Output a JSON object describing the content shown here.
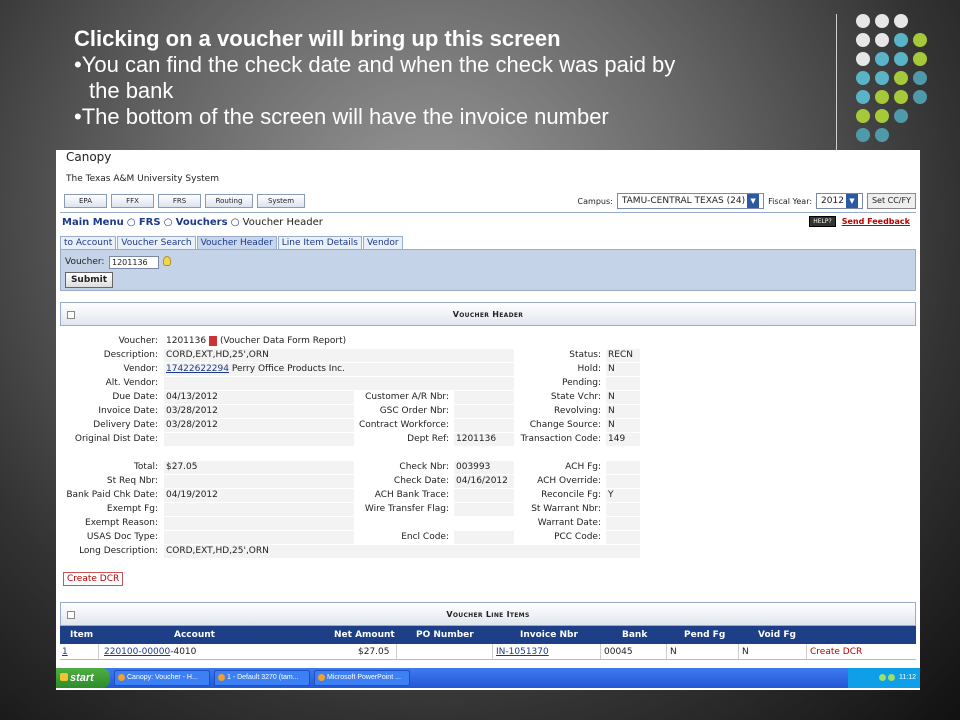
{
  "slide": {
    "title": "Clicking on a voucher will bring up this screen",
    "bullet1": "•You can find the check date and when the check was paid by",
    "bullet1b": "the bank",
    "bullet2": "•The bottom of the screen will have the invoice number"
  },
  "header": {
    "brand_cut": "Canopy",
    "org": "The Texas A&M University System",
    "nav": [
      "EPA",
      "FFX",
      "FRS",
      "Routing",
      "System"
    ],
    "campus_label": "Campus:",
    "campus_value": "TAMU-CENTRAL TEXAS (24)",
    "fy_label": "Fiscal Year:",
    "fy_value": "2012",
    "set_btn": "Set CC/FY"
  },
  "breadcrumb": {
    "main": "Main Menu",
    "sep1": "○",
    "frs": "FRS",
    "sep2": "○",
    "vouchers": "Vouchers",
    "sep3": "○",
    "current": "Voucher Header"
  },
  "help": {
    "help": "HELP?",
    "feedback": "Send Feedback"
  },
  "tabs": [
    "to Account",
    "Voucher Search",
    "Voucher Header",
    "Line Item Details",
    "Vendor"
  ],
  "search": {
    "label": "Voucher:",
    "value": "1201136",
    "submit": "Submit"
  },
  "section_header": "Voucher Header",
  "fields": {
    "voucher_l": "Voucher:",
    "voucher_v": "1201136",
    "voucher_report": "(Voucher Data Form Report)",
    "desc_l": "Description:",
    "desc_v": "CORD,EXT,HD,25',ORN",
    "vendor_l": "Vendor:",
    "vendor_id": "17422622294",
    "vendor_name": "Perry Office Products Inc.",
    "altvendor_l": "Alt. Vendor:",
    "due_l": "Due Date:",
    "due_v": "04/13/2012",
    "inv_l": "Invoice Date:",
    "inv_v": "03/28/2012",
    "del_l": "Delivery Date:",
    "del_v": "03/28/2012",
    "odd_l": "Original Dist Date:",
    "custar_l": "Customer A/R Nbr:",
    "gsc_l": "GSC Order Nbr:",
    "cw_l": "Contract Workforce:",
    "dept_l": "Dept Ref:",
    "dept_v": "1201136",
    "status_l": "Status:",
    "status_v": "RECN",
    "hold_l": "Hold:",
    "hold_v": "N",
    "pending_l": "Pending:",
    "statev_l": "State Vchr:",
    "statev_v": "N",
    "revolv_l": "Revolving:",
    "revolv_v": "N",
    "change_l": "Change Source:",
    "change_v": "N",
    "trans_l": "Transaction Code:",
    "trans_v": "149",
    "total_l": "Total:",
    "total_v": "$27.05",
    "streq_l": "St Req Nbr:",
    "bank_l": "Bank Paid Chk Date:",
    "bank_v": "04/19/2012",
    "exfg_l": "Exempt Fg:",
    "exreason_l": "Exempt Reason:",
    "usas_l": "USAS Doc Type:",
    "longdesc_l": "Long Description:",
    "longdesc_v": "CORD,EXT,HD,25',ORN",
    "checknbr_l": "Check Nbr:",
    "checknbr_v": "003993",
    "checkdate_l": "Check Date:",
    "checkdate_v": "04/16/2012",
    "achtrace_l": "ACH Bank Trace:",
    "wire_l": "Wire Transfer Flag:",
    "encl_l": "Encl Code:",
    "achfg_l": "ACH Fg:",
    "achover_l": "ACH Override:",
    "reconcile_l": "Reconcile Fg:",
    "reconcile_v": "Y",
    "stwarrant_l": "St Warrant Nbr:",
    "wdate_l": "Warrant Date:",
    "pcc_l": "PCC Code:"
  },
  "create_dcr": "Create DCR",
  "line_items_header": "Voucher Line Items",
  "line_columns": [
    "Item",
    "Account",
    "Net Amount",
    "PO Number",
    "Invoice Nbr",
    "Bank",
    "Pend Fg",
    "Void Fg"
  ],
  "line_row": {
    "item": "1",
    "account_link": "220100-00000",
    "account_rest": "-4010",
    "net": "$27.05",
    "po": "",
    "invoice": "IN-1051370",
    "bank": "00045",
    "pend": "N",
    "void": "N",
    "action": "Create DCR"
  },
  "taskbar": {
    "start": "start",
    "tasks": [
      "Canopy: Voucher - H...",
      "1 - Default 3270 (tam...",
      "Microsoft PowerPoint ..."
    ],
    "clock": "11:12"
  }
}
